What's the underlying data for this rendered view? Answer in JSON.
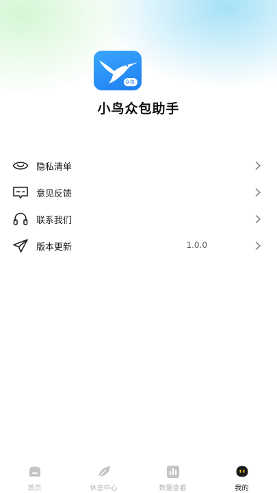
{
  "app": {
    "name": "小鸟众包助手",
    "logo_badge": "众包"
  },
  "menu": [
    {
      "label": "隐私清单",
      "icon": "eye-icon"
    },
    {
      "label": "意见反馈",
      "icon": "feedback-icon"
    },
    {
      "label": "联系我们",
      "icon": "headset-icon"
    },
    {
      "label": "版本更新",
      "icon": "send-icon",
      "value": "1.0.0"
    }
  ],
  "tabs": [
    {
      "label": "首页",
      "icon": "home-icon"
    },
    {
      "label": "休息中心",
      "icon": "leaf-icon"
    },
    {
      "label": "数据查看",
      "icon": "chart-icon"
    },
    {
      "label": "我的",
      "icon": "mascot-icon",
      "active": true
    }
  ],
  "colors": {
    "brand": "#2f8cf8",
    "inactive": "#b5b5b5",
    "text": "#1a1a1a"
  }
}
